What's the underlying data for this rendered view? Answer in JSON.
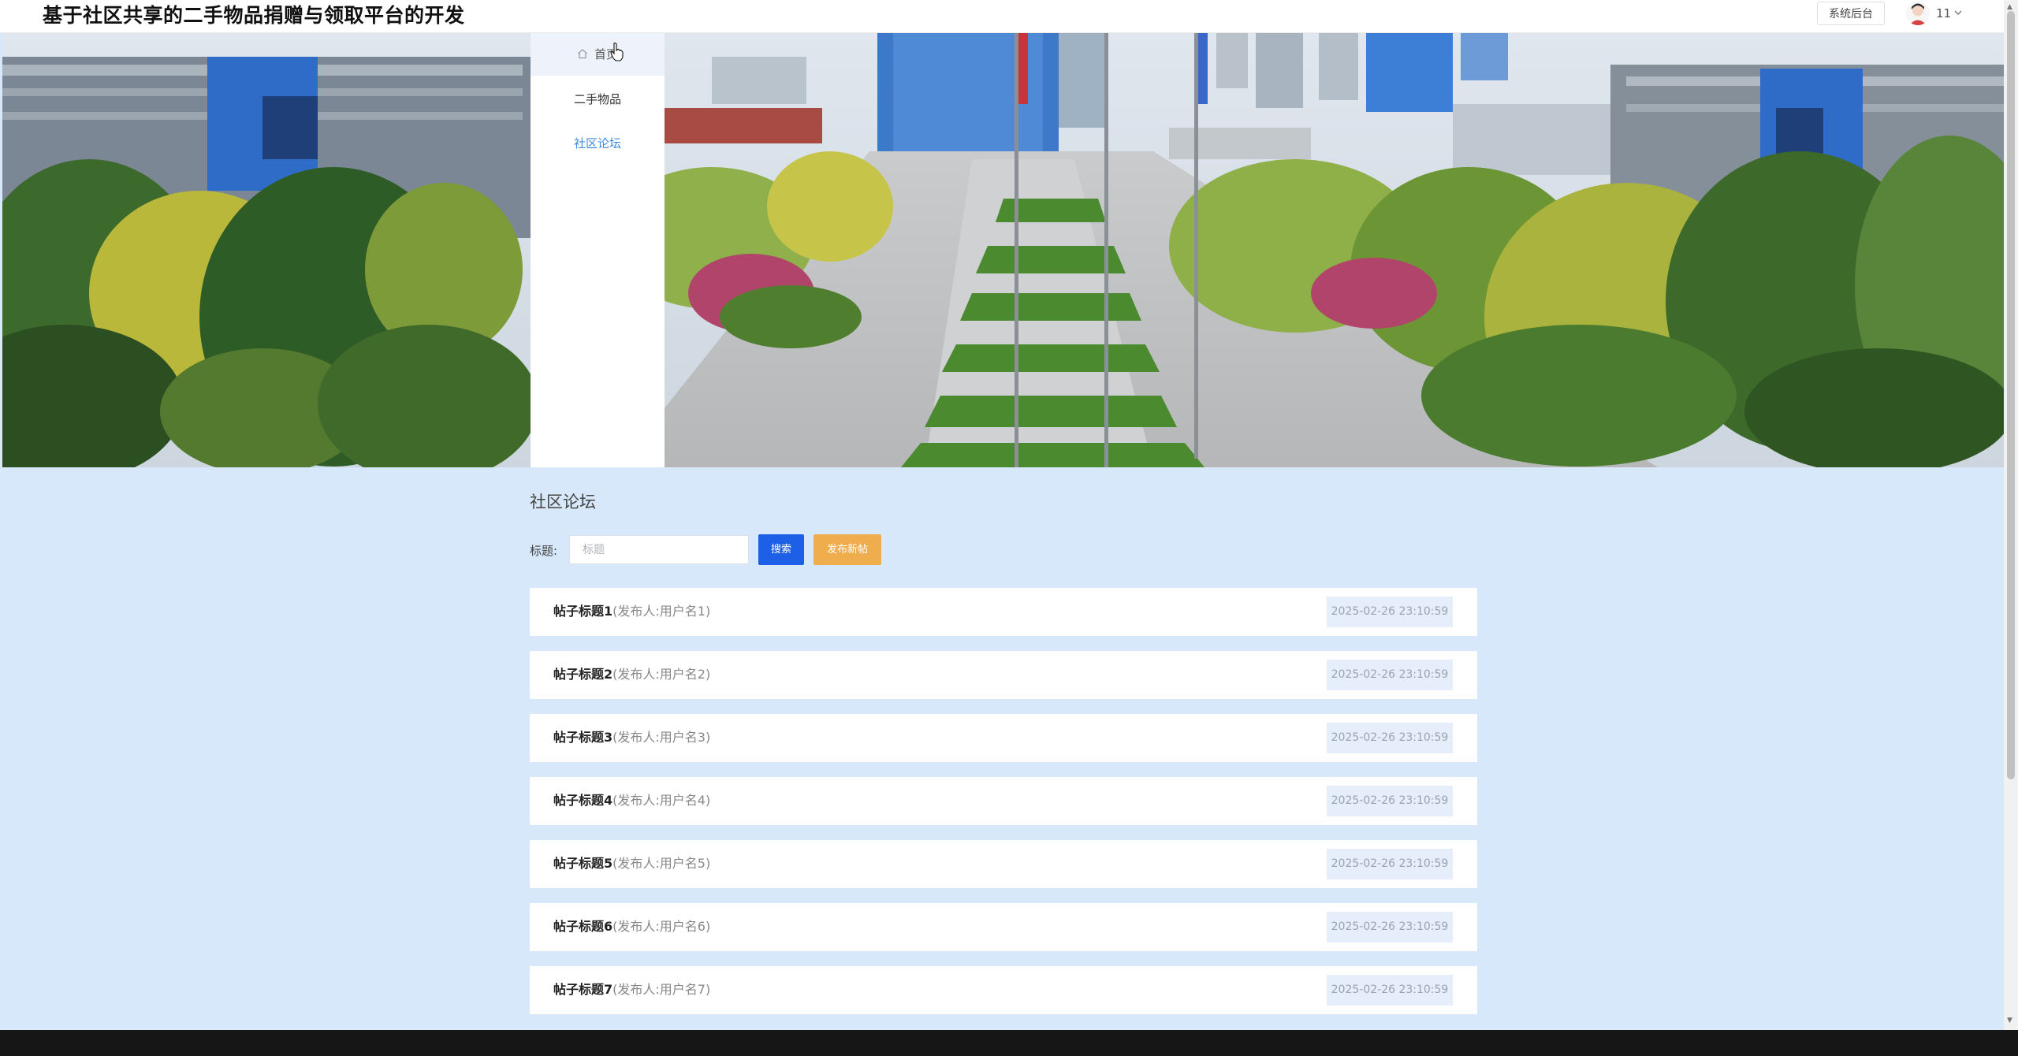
{
  "header": {
    "site_title": "基于社区共享的二手物品捐赠与领取平台的开发",
    "admin_label": "系统后台",
    "user_name": "11"
  },
  "nav": {
    "items": [
      {
        "label": "首页",
        "icon": "home-icon"
      },
      {
        "label": "二手物品"
      },
      {
        "label": "社区论坛"
      }
    ],
    "active_color": "#3b8de4"
  },
  "forum": {
    "title": "社区论坛",
    "search_label": "标题:",
    "search_placeholder": "标题",
    "search_button": "搜索",
    "post_button": "发布新帖",
    "posts": [
      {
        "title": "帖子标题1",
        "author": "(发布人:用户名1)",
        "date": "2025-02-26 23:10:59"
      },
      {
        "title": "帖子标题2",
        "author": "(发布人:用户名2)",
        "date": "2025-02-26 23:10:59"
      },
      {
        "title": "帖子标题3",
        "author": "(发布人:用户名3)",
        "date": "2025-02-26 23:10:59"
      },
      {
        "title": "帖子标题4",
        "author": "(发布人:用户名4)",
        "date": "2025-02-26 23:10:59"
      },
      {
        "title": "帖子标题5",
        "author": "(发布人:用户名5)",
        "date": "2025-02-26 23:10:59"
      },
      {
        "title": "帖子标题6",
        "author": "(发布人:用户名6)",
        "date": "2025-02-26 23:10:59"
      },
      {
        "title": "帖子标题7",
        "author": "(发布人:用户名7)",
        "date": "2025-02-26 23:10:59"
      }
    ]
  },
  "colors": {
    "page_background": "#d6e8f9",
    "search_button": "#1e5fe8",
    "post_button": "#f0ad4e"
  }
}
